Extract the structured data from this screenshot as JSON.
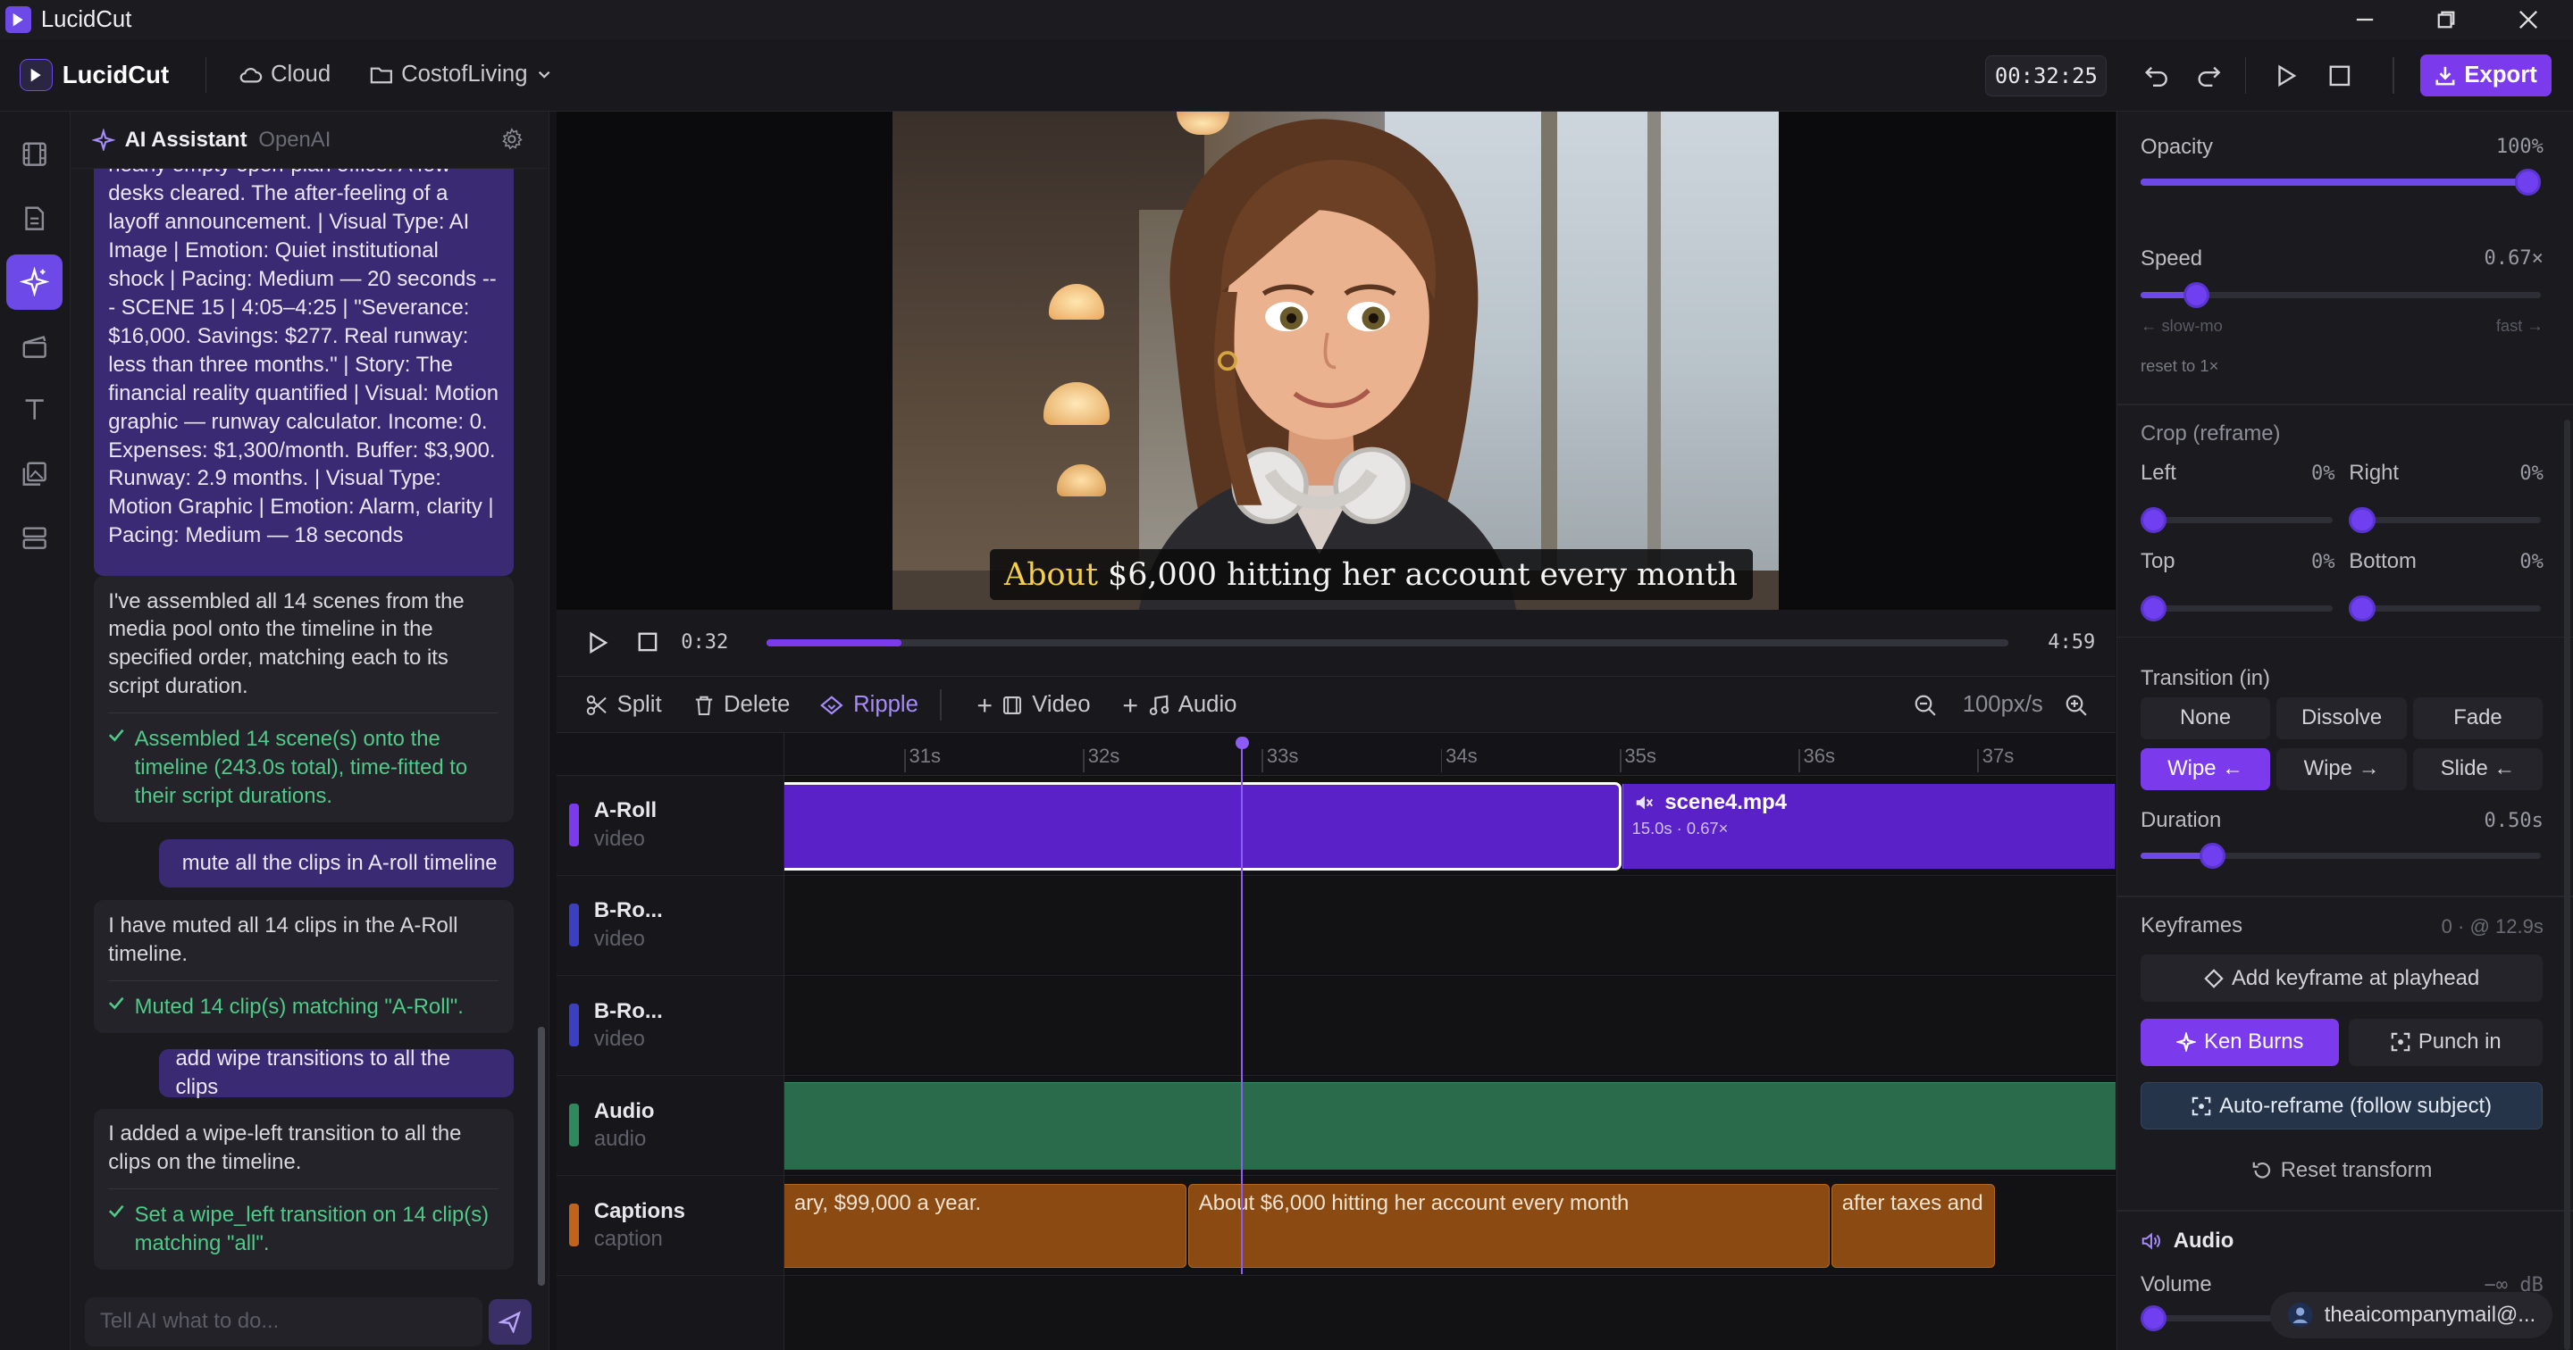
{
  "window": {
    "title": "LucidCut"
  },
  "app": {
    "brand": "LucidCut",
    "cloud_label": "Cloud",
    "project_label": "CostofLiving",
    "timecode": "00:32:25",
    "export_label": "Export"
  },
  "ai": {
    "title": "AI Assistant",
    "provider": "OpenAI",
    "messages": {
      "m1": "nearly empty open-plan office. A few desks cleared. The after-feeling of a layoff announcement. | Visual Type: AI Image | Emotion: Quiet institutional shock | Pacing: Medium — 20 seconds -- - SCENE 15 | 4:05–4:25 | \"Severance: $16,000. Savings: $277. Real runway: less than three months.\" | Story: The financial reality quantified | Visual: Motion graphic — runway calculator. Income: 0. Expenses: $1,300/month. Buffer: $3,900. Runway: 2.9 months. | Visual Type: Motion Graphic | Emotion: Alarm, clarity | Pacing: Medium — 18 seconds",
      "m2_text": "I've assembled all 14 scenes from the media pool onto the timeline in the specified order, matching each to its script duration.",
      "m2_ok": "Assembled 14 scene(s) onto the timeline (243.0s total), time-fitted to their script durations.",
      "m3": "mute all the clips in A-roll timeline",
      "m4_text": "I have muted all 14 clips in the A-Roll timeline.",
      "m4_ok": "Muted 14 clip(s) matching \"A-Roll\".",
      "m5": "add wipe transitions to all the clips",
      "m6_text": "I added a wipe-left transition to all the clips on the timeline.",
      "m6_ok": "Set a wipe_left transition on 14 clip(s) matching \"all\"."
    },
    "input_placeholder": "Tell AI what to do..."
  },
  "preview": {
    "subtitle_highlight": "About",
    "subtitle_rest": "$6,000 hitting her account every month",
    "current_time": "0:32",
    "duration": "4:59",
    "progress": 0.109
  },
  "toolbar": {
    "split": "Split",
    "delete": "Delete",
    "ripple": "Ripple",
    "add_video": "Video",
    "add_audio": "Audio",
    "zoom": "100px/s"
  },
  "ruler": [
    "31s",
    "32s",
    "33s",
    "34s",
    "35s",
    "36s",
    "37s"
  ],
  "tracks": [
    {
      "name": "A-Roll",
      "type": "video",
      "color": "#7c3aed"
    },
    {
      "name": "B-Ro...",
      "type": "video",
      "color": "#3b3fc2"
    },
    {
      "name": "B-Ro...",
      "type": "video",
      "color": "#3b3fc2"
    },
    {
      "name": "Audio",
      "type": "audio",
      "color": "#2e8a5c"
    },
    {
      "name": "Captions",
      "type": "caption",
      "color": "#c2631c"
    }
  ],
  "clips": {
    "aroll_name": "scene4.mp4",
    "aroll_meta": "15.0s · 0.67×",
    "captions": [
      "ary, $99,000 a year.",
      "About $6,000 hitting her account every month",
      "after taxes and"
    ]
  },
  "props": {
    "opacity_label": "Opacity",
    "opacity_value": "100%",
    "opacity": 1.0,
    "speed_label": "Speed",
    "speed_value": "0.67×",
    "speed": 0.14,
    "slow_label": "← slow-mo",
    "fast_label": "fast →",
    "reset_speed": "reset to 1×",
    "crop_label": "Crop (reframe)",
    "crop_left": "Left",
    "crop_left_value": "0%",
    "crop_right": "Right",
    "crop_right_value": "0%",
    "crop_top": "Top",
    "crop_top_value": "0%",
    "crop_bottom": "Bottom",
    "crop_bottom_value": "0%",
    "transition_label": "Transition (in)",
    "transitions": [
      "None",
      "Dissolve",
      "Fade",
      "Wipe ←",
      "Wipe →",
      "Slide ←"
    ],
    "duration_label": "Duration",
    "duration_value": "0.50s",
    "duration": 0.18,
    "keyframes_label": "Keyframes",
    "keyframes_value": "0 · @ 12.9s",
    "add_keyframe": "Add keyframe at playhead",
    "ken_burns": "Ken Burns",
    "punch_in": "Punch in",
    "auto_reframe": "Auto-reframe (follow subject)",
    "reset_transform": "Reset transform",
    "audio_label": "Audio",
    "volume_label": "Volume",
    "volume_value": "−∞ dB"
  },
  "account": {
    "email": "theaicompanymail@..."
  },
  "colors": {
    "accent": "#7c3aed",
    "success": "#4ecb88",
    "caption_clip": "#8a4a12",
    "audio_clip": "#2a6b4c"
  }
}
